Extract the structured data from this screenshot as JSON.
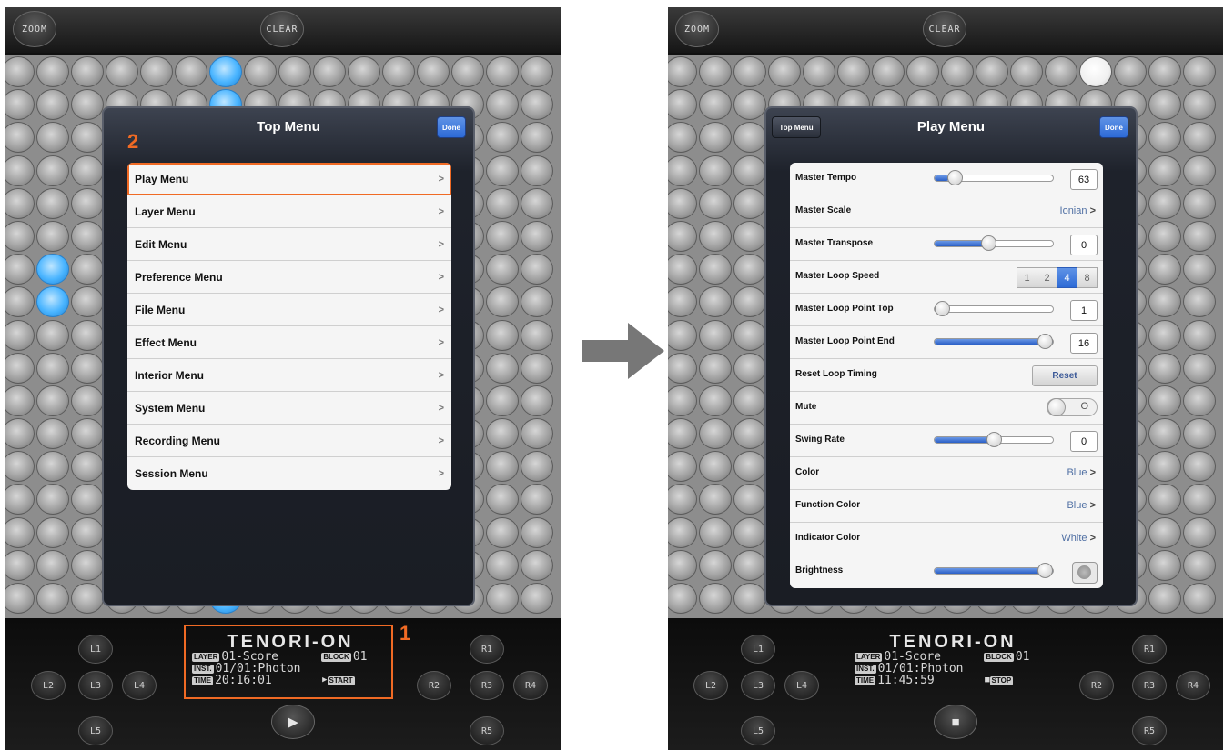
{
  "left": {
    "top_buttons": {
      "zoom": "ZOOM",
      "clear": "CLEAR"
    },
    "popover": {
      "title": "Top Menu",
      "done_label": "Done",
      "items": [
        {
          "label": "Play Menu",
          "chevron": ">"
        },
        {
          "label": "Layer Menu",
          "chevron": ">"
        },
        {
          "label": "Edit Menu",
          "chevron": ">"
        },
        {
          "label": "Preference Menu",
          "chevron": ">"
        },
        {
          "label": "File Menu",
          "chevron": ">"
        },
        {
          "label": "Effect Menu",
          "chevron": ">"
        },
        {
          "label": "Interior Menu",
          "chevron": ">"
        },
        {
          "label": "System Menu",
          "chevron": ">"
        },
        {
          "label": "Recording Menu",
          "chevron": ">"
        },
        {
          "label": "Session Menu",
          "chevron": ">"
        }
      ]
    },
    "lcd": {
      "title": "TENORI-ON",
      "layer_tag": "LAYER",
      "layer": "01-Score",
      "block_tag": "BLOCK",
      "block": "01",
      "inst_tag": "INST.",
      "inst": "01/01:Photon",
      "time_tag": "TIME",
      "time": "20:16:01",
      "transport": "START"
    },
    "controls": {
      "l1": "L1",
      "l2": "L2",
      "l3": "L3",
      "l4": "L4",
      "l5": "L5",
      "r1": "R1",
      "r2": "R2",
      "r3": "R3",
      "r4": "R4",
      "r5": "R5",
      "play_icon": "▶"
    },
    "callouts": {
      "lcd_number": "1",
      "menu_number": "2",
      "color": "#f06a24"
    }
  },
  "right": {
    "top_buttons": {
      "zoom": "ZOOM",
      "clear": "CLEAR"
    },
    "popover": {
      "title": "Play Menu",
      "back_label": "Top Menu",
      "done_label": "Done",
      "rows": {
        "tempo": {
          "label": "Master Tempo",
          "value": "63",
          "level": 0.12
        },
        "scale": {
          "label": "Master Scale",
          "value": "Ionian"
        },
        "transpose": {
          "label": "Master Transpose",
          "value": "0",
          "level": 0.45
        },
        "loop_speed": {
          "label": "Master Loop Speed",
          "options": [
            "1",
            "2",
            "4",
            "8"
          ],
          "selected": "4"
        },
        "loop_top": {
          "label": "Master Loop Point Top",
          "value": "1",
          "level": 0.0
        },
        "loop_end": {
          "label": "Master Loop Point End",
          "value": "16",
          "level": 1.0
        },
        "reset_timing": {
          "label": "Reset Loop Timing",
          "button": "Reset"
        },
        "mute": {
          "label": "Mute",
          "toggle_text": "O"
        },
        "swing": {
          "label": "Swing Rate",
          "value": "0",
          "level": 0.5
        },
        "color": {
          "label": "Color",
          "value": "Blue"
        },
        "function_color": {
          "label": "Function Color",
          "value": "Blue"
        },
        "indicator_color": {
          "label": "Indicator Color",
          "value": "White"
        },
        "brightness": {
          "label": "Brightness",
          "level": 1.0
        }
      }
    },
    "lcd": {
      "title": "TENORI-ON",
      "layer_tag": "LAYER",
      "layer": "01-Score",
      "block_tag": "BLOCK",
      "block": "01",
      "inst_tag": "INST.",
      "inst": "01/01:Photon",
      "time_tag": "TIME",
      "time": "11:45:59",
      "transport": "STOP"
    },
    "controls": {
      "l1": "L1",
      "l2": "L2",
      "l3": "L3",
      "l4": "L4",
      "l5": "L5",
      "r1": "R1",
      "r2": "R2",
      "r3": "R3",
      "r4": "R4",
      "r5": "R5",
      "stop_icon": "■"
    }
  },
  "colors": {
    "accent_blue": "#49b4ff",
    "callout_orange": "#f06a24",
    "arrow_gray": "#777777"
  }
}
